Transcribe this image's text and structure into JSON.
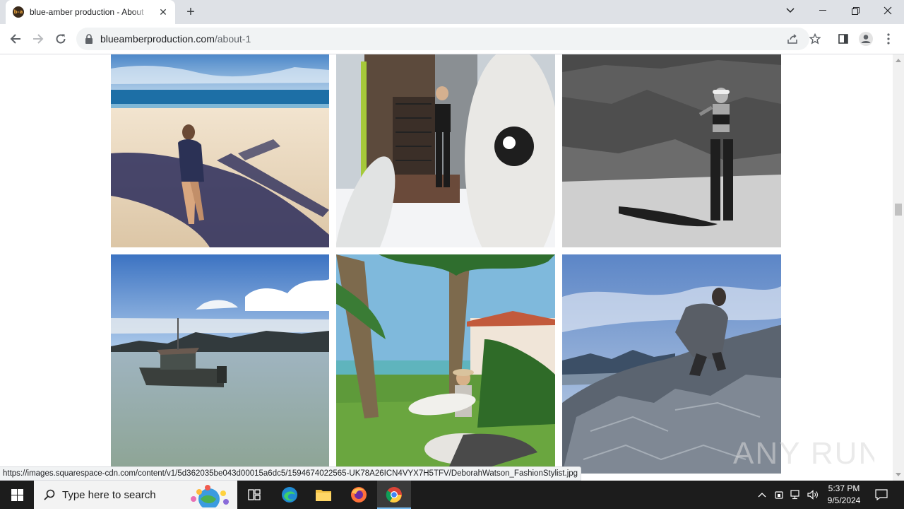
{
  "browser": {
    "tab_title": "blue-amber production - About",
    "favicon_text": "b-a",
    "url_domain": "blueamberproduction.com",
    "url_path": "/about-1",
    "new_tab_symbol": "+",
    "status_url": "https://images.squarespace-cdn.com/content/v1/5d362035be043d00015a6dc5/1594674022565-UK78A26ICN4VYX7H5TFV/DeborahWatson_FashionStylist.jpg"
  },
  "gallery": {
    "photos": [
      {
        "label": "woman-on-beach-photo"
      },
      {
        "label": "woman-with-snowboards-photo"
      },
      {
        "label": "woman-hiking-bw-photo"
      },
      {
        "label": "boat-on-lake-photo"
      },
      {
        "label": "surfer-under-palms-photo"
      },
      {
        "label": "woman-on-rocks-photo"
      }
    ]
  },
  "watermark": {
    "text": "ANY RUN"
  },
  "taskbar": {
    "search_placeholder": "Type here to search",
    "time": "5:37 PM",
    "date": "9/5/2024"
  }
}
